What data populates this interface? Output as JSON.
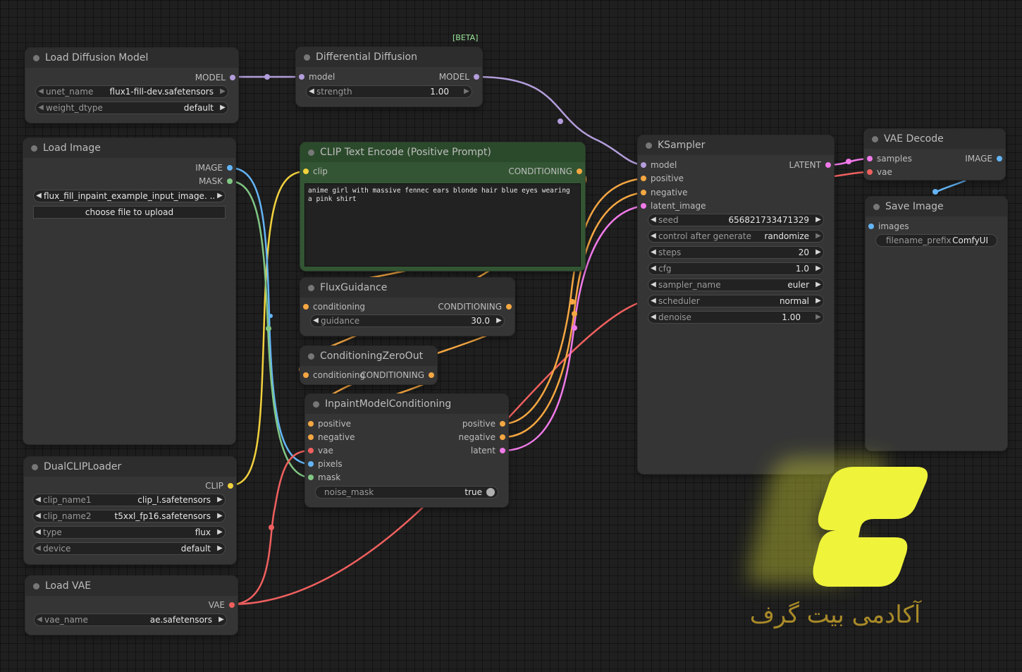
{
  "colors": {
    "model": "#b39ddb",
    "clip": "#f2d13d",
    "conditioning": "#f5a742",
    "latent": "#f07ae8",
    "vae": "#f0605f",
    "image": "#64b5f6",
    "mask": "#81c784",
    "brand": "#eff33a",
    "brand_text": "#b8962a"
  },
  "nodes": {
    "load_diffusion": {
      "title": "Load Diffusion Model",
      "out_model": "MODEL",
      "w_unet_label": "unet_name",
      "w_unet_value": "flux1-fill-dev.safetensors",
      "w_dtype_label": "weight_dtype",
      "w_dtype_value": "default"
    },
    "diff_diffusion": {
      "badge": "[BETA]",
      "title": "Differential Diffusion",
      "in_model": "model",
      "out_model": "MODEL",
      "w_strength_label": "strength",
      "w_strength_value": "1.00"
    },
    "load_image": {
      "title": "Load Image",
      "out_image": "IMAGE",
      "out_mask": "MASK",
      "w_image_value": "flux_fill_inpaint_example_input_image. ...",
      "upload_label": "choose file to upload"
    },
    "clip_text": {
      "title": "CLIP Text Encode (Positive Prompt)",
      "in_clip": "clip",
      "out_cond": "CONDITIONING",
      "prompt": "anime girl with massive fennec ears blonde hair blue eyes wearing a pink shirt"
    },
    "flux_guidance": {
      "title": "FluxGuidance",
      "in_cond": "conditioning",
      "out_cond": "CONDITIONING",
      "w_guidance_label": "guidance",
      "w_guidance_value": "30.0"
    },
    "cond_zero": {
      "title": "ConditioningZeroOut",
      "in_cond": "conditioning",
      "out_cond": "CONDITIONING"
    },
    "inpaint": {
      "title": "InpaintModelConditioning",
      "in_positive": "positive",
      "in_negative": "negative",
      "in_vae": "vae",
      "in_pixels": "pixels",
      "in_mask": "mask",
      "out_positive": "positive",
      "out_negative": "negative",
      "out_latent": "latent",
      "w_noise_label": "noise_mask",
      "w_noise_value": "true"
    },
    "ksampler": {
      "title": "KSampler",
      "in_model": "model",
      "in_positive": "positive",
      "in_negative": "negative",
      "in_latent": "latent_image",
      "out_latent": "LATENT",
      "w_seed_label": "seed",
      "w_seed_value": "656821733471329",
      "w_control_label": "control after generate",
      "w_control_value": "randomize",
      "w_steps_label": "steps",
      "w_steps_value": "20",
      "w_cfg_label": "cfg",
      "w_cfg_value": "1.0",
      "w_sampler_label": "sampler_name",
      "w_sampler_value": "euler",
      "w_scheduler_label": "scheduler",
      "w_scheduler_value": "normal",
      "w_denoise_label": "denoise",
      "w_denoise_value": "1.00"
    },
    "vae_decode": {
      "title": "VAE Decode",
      "in_samples": "samples",
      "in_vae": "vae",
      "out_image": "IMAGE"
    },
    "save_image": {
      "title": "Save Image",
      "in_images": "images",
      "w_prefix_label": "filename_prefix",
      "w_prefix_value": "ComfyUI"
    },
    "dual_clip": {
      "title": "DualCLIPLoader",
      "out_clip": "CLIP",
      "w_clip1_label": "clip_name1",
      "w_clip1_value": "clip_l.safetensors",
      "w_clip2_label": "clip_name2",
      "w_clip2_value": "t5xxl_fp16.safetensors",
      "w_type_label": "type",
      "w_type_value": "flux",
      "w_device_label": "device",
      "w_device_value": "default"
    },
    "load_vae": {
      "title": "Load VAE",
      "out_vae": "VAE",
      "w_vae_label": "vae_name",
      "w_vae_value": "ae.safetensors"
    }
  },
  "watermark": {
    "icon": "brand-c-logo-icon",
    "text": "آکادمی بیت گرف"
  }
}
